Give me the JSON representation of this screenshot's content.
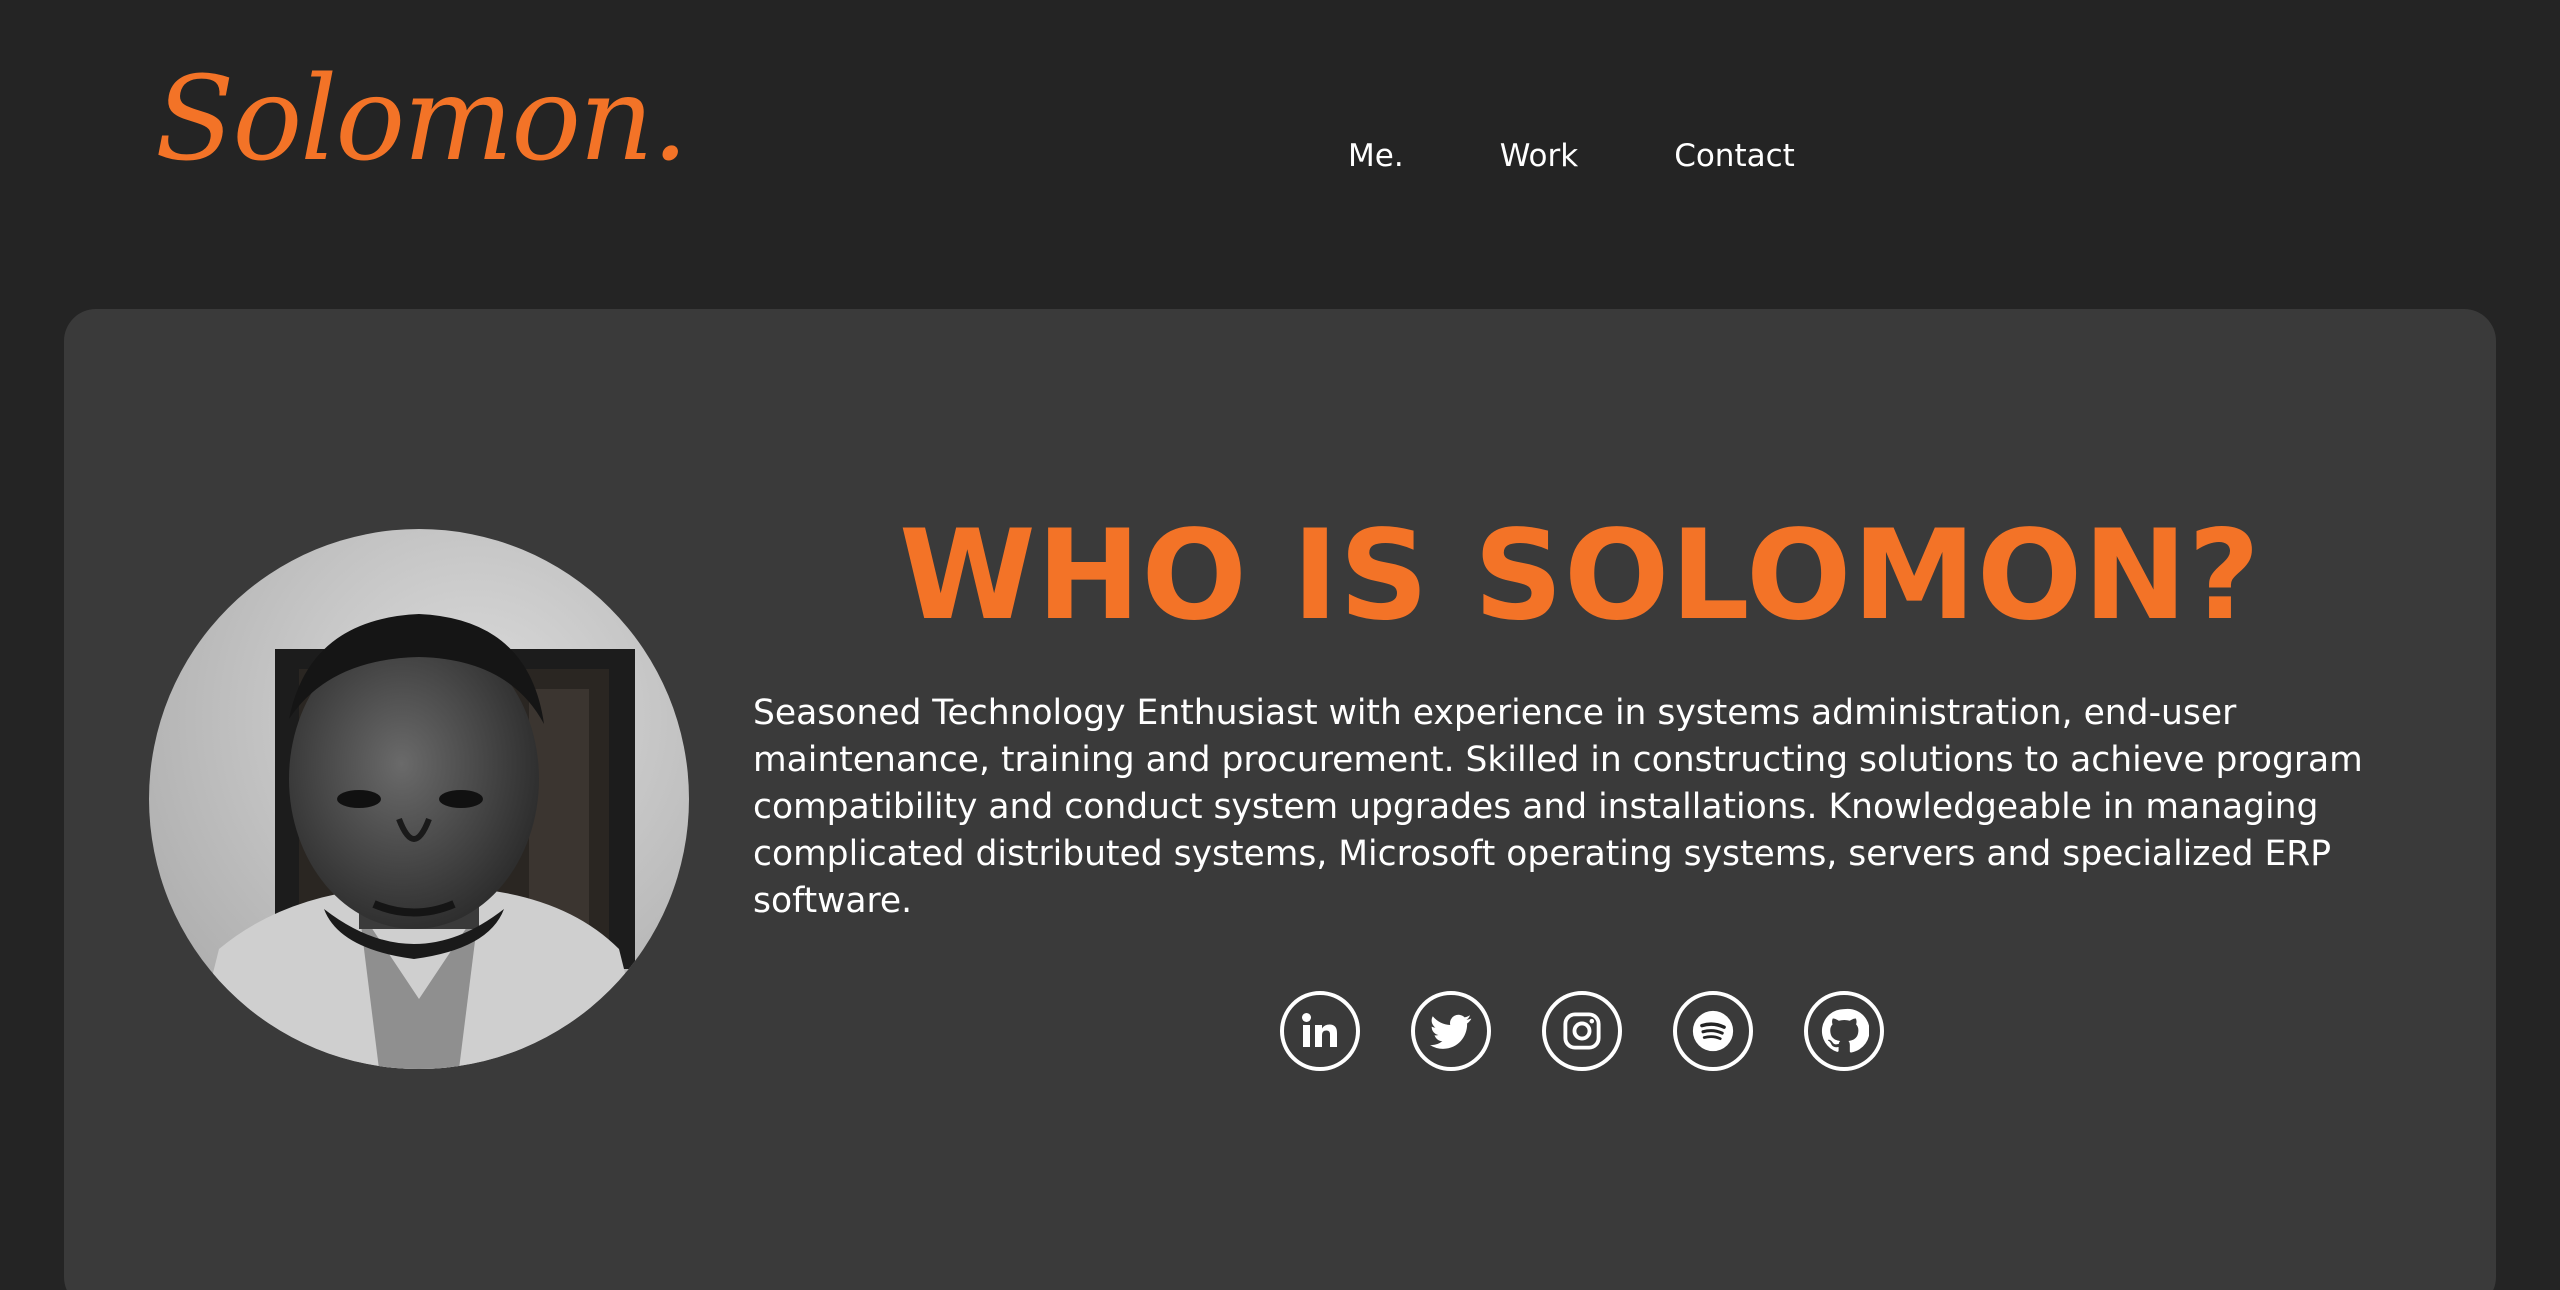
{
  "header": {
    "logo": "Solomon.",
    "nav": [
      {
        "label": "Me."
      },
      {
        "label": "Work"
      },
      {
        "label": "Contact"
      }
    ]
  },
  "hero": {
    "heading": "WHO IS SOLOMON?",
    "bio": "Seasoned Technology Enthusiast with experience in systems administration, end-user maintenance, training and procurement. Skilled in constructing solutions to achieve program compatibility and conduct system upgrades and installations. Knowledgeable in managing complicated distributed systems, Microsoft operating systems, servers and specialized ERP software.",
    "avatar_icon": "profile-photo",
    "socials": [
      {
        "icon": "linkedin-icon"
      },
      {
        "icon": "twitter-icon"
      },
      {
        "icon": "instagram-icon"
      },
      {
        "icon": "spotify-icon"
      },
      {
        "icon": "github-icon"
      }
    ]
  },
  "colors": {
    "background": "#242424",
    "card": "#3a3a3a",
    "accent": "#f37327",
    "text": "#ffffff"
  }
}
